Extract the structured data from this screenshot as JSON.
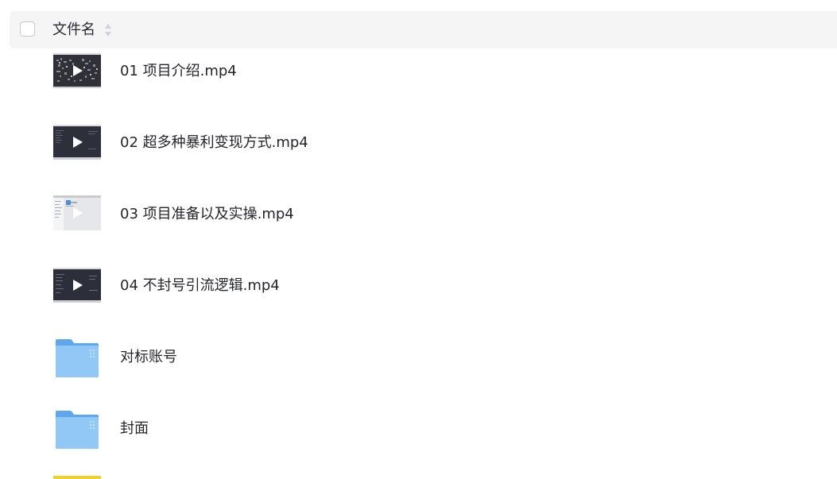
{
  "header": {
    "column_label": "文件名",
    "sort_icon": "sort-icon"
  },
  "files": [
    {
      "name": "01 项目介绍.mp4",
      "type": "video",
      "thumb_style": "dark-noisy",
      "icon": "play-icon"
    },
    {
      "name": "02 超多种暴利变现方式.mp4",
      "type": "video",
      "thumb_style": "dark",
      "icon": "play-icon"
    },
    {
      "name": "03 项目准备以及实操.mp4",
      "type": "video",
      "thumb_style": "light",
      "icon": "play-icon"
    },
    {
      "name": "04 不封号引流逻辑.mp4",
      "type": "video",
      "thumb_style": "dark",
      "icon": "play-icon"
    },
    {
      "name": "对标账号",
      "type": "folder",
      "icon": "folder-icon"
    },
    {
      "name": "封面",
      "type": "folder",
      "icon": "folder-icon"
    }
  ],
  "colors": {
    "header_bg": "#f5f5f6",
    "folder_front": "#8ec5f4",
    "folder_back": "#5fa8ee",
    "video_dark": "#2d2f3a",
    "video_light": "#e4e6ea",
    "partial_item": "#f5d327"
  }
}
